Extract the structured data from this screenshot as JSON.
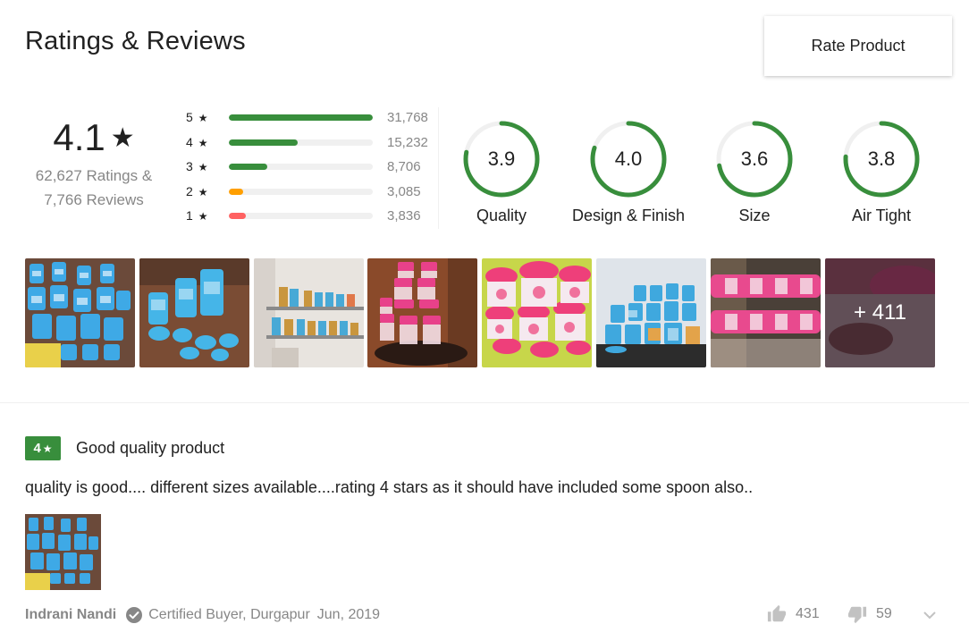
{
  "header": {
    "title": "Ratings & Reviews",
    "rate_button": "Rate Product"
  },
  "summary": {
    "average": "4.1",
    "star": "★",
    "ratings_text": "62,627 Ratings &",
    "reviews_text": "7,766 Reviews"
  },
  "distribution": [
    {
      "label": "5",
      "star": "★",
      "count": "31,768",
      "fraction": 1.0,
      "color": "#388e3c"
    },
    {
      "label": "4",
      "star": "★",
      "count": "15,232",
      "fraction": 0.48,
      "color": "#388e3c"
    },
    {
      "label": "3",
      "star": "★",
      "count": "8,706",
      "fraction": 0.27,
      "color": "#388e3c"
    },
    {
      "label": "2",
      "star": "★",
      "count": "3,085",
      "fraction": 0.1,
      "color": "#ff9f00"
    },
    {
      "label": "1",
      "star": "★",
      "count": "3,836",
      "fraction": 0.12,
      "color": "#ff6161"
    }
  ],
  "aspects": [
    {
      "value": "3.9",
      "label": "Quality",
      "score": 3.9
    },
    {
      "value": "4.0",
      "label": "Design & Finish",
      "score": 4.0
    },
    {
      "value": "3.6",
      "label": "Size",
      "score": 3.6
    },
    {
      "value": "3.8",
      "label": "Air Tight",
      "score": 3.8
    }
  ],
  "colors": {
    "green": "#388e3c",
    "ring_track": "#f0f0f0"
  },
  "gallery": {
    "more_label": "+ 411"
  },
  "review": {
    "rating": "4",
    "star": "★",
    "title": "Good quality product",
    "text": "quality is good.... different sizes available....rating 4 stars as it should have included some spoon also..",
    "author": "Indrani Nandi",
    "certified": "Certified Buyer, Durgapur",
    "date": "Jun, 2019",
    "upvotes": "431",
    "downvotes": "59"
  }
}
